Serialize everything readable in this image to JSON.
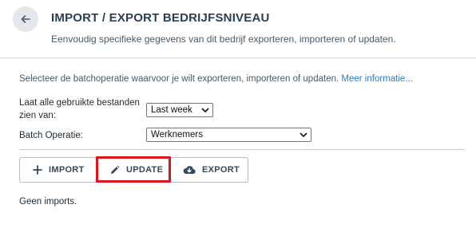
{
  "header": {
    "title": "IMPORT / EXPORT BEDRIJFSNIVEAU",
    "subtitle": "Eenvoudig specifieke gegevens van dit bedrijf exporteren, importeren of updaten."
  },
  "intro": {
    "text": "Selecteer de batchoperatie waarvoor je wilt exporteren, importeren of updaten.",
    "link": "Meer informatie..."
  },
  "form": {
    "files_label": "Laat alle gebruikte bestanden zien van:",
    "files_value": "Last week",
    "batch_label": "Batch Operatie:",
    "batch_value": "Werknemers"
  },
  "actions": {
    "import_label": "IMPORT",
    "update_label": "UPDATE",
    "export_label": "EXPORT"
  },
  "status": {
    "empty_text": "Geen imports."
  },
  "colors": {
    "highlight": "#e0141c",
    "link": "#2f7dc8",
    "back_button_bg": "#e3e7ec"
  }
}
